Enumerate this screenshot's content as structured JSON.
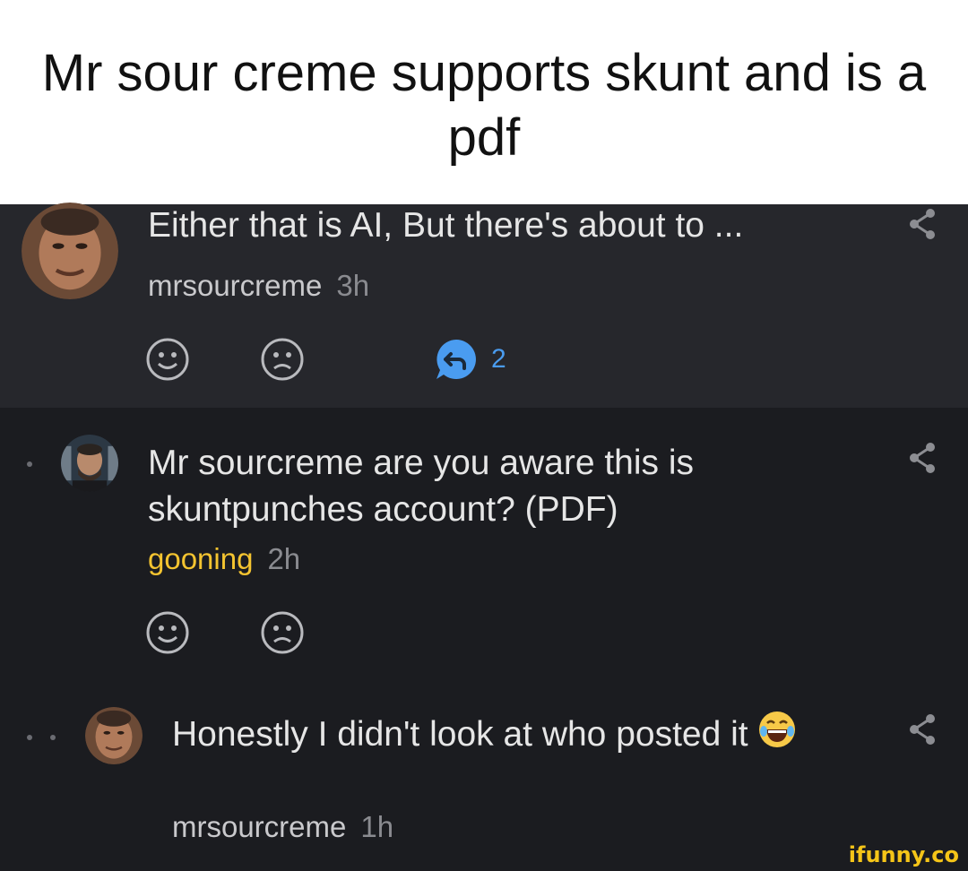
{
  "caption": "Mr sour creme supports skunt and is a pdf",
  "comments": [
    {
      "text": "Either that is AI, But there's about to ...",
      "username": "mrsourcreme",
      "time": "3h",
      "reply_count": "2"
    },
    {
      "text": "Mr sourcreme are you aware this is skuntpunches account? (PDF)",
      "username": "gooning",
      "time": "2h"
    },
    {
      "text": "Honestly I didn't look at who posted it",
      "username": "mrsourcreme",
      "time": "1h"
    }
  ],
  "watermark": "ifunny.co",
  "colors": {
    "panel_highlight": "#26272c",
    "background": "#1b1c20",
    "reply_accent": "#4a9cf0",
    "gold_username": "#f4c430"
  },
  "icons": [
    "smile-icon",
    "frown-icon",
    "reply-icon",
    "share-icon",
    "laughing-emoji"
  ]
}
